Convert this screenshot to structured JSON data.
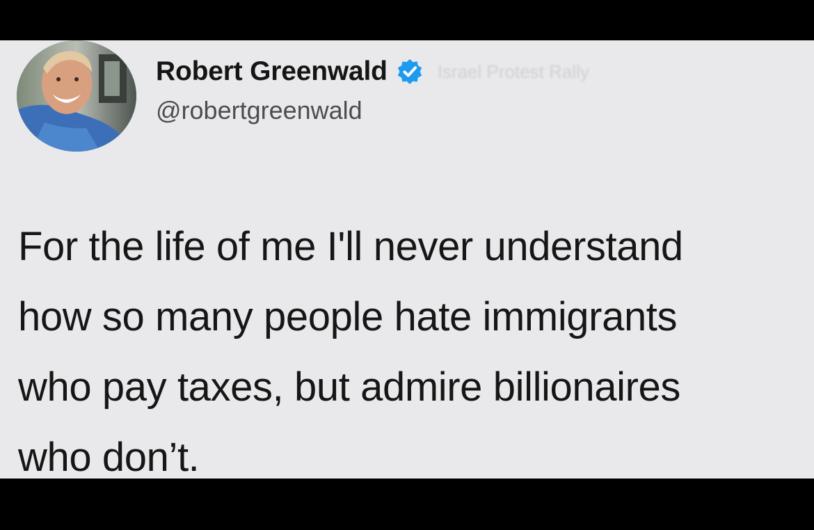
{
  "author": {
    "display_name": "Robert Greenwald",
    "handle": "@robertgreenwald",
    "verified": true,
    "faint_text": "Israel Protest Rally",
    "avatar": "profile-photo"
  },
  "tweet": {
    "lines": [
      "For the life of me I'll never understand",
      "how so many people hate immigrants",
      "who pay taxes, but admire billionaires",
      "who don’t."
    ]
  },
  "colors": {
    "background": "#e9e9eb",
    "letterbox": "#000000",
    "verified_badge": "#1d9bf0",
    "text": "#161616",
    "handle": "#4a4d52"
  }
}
